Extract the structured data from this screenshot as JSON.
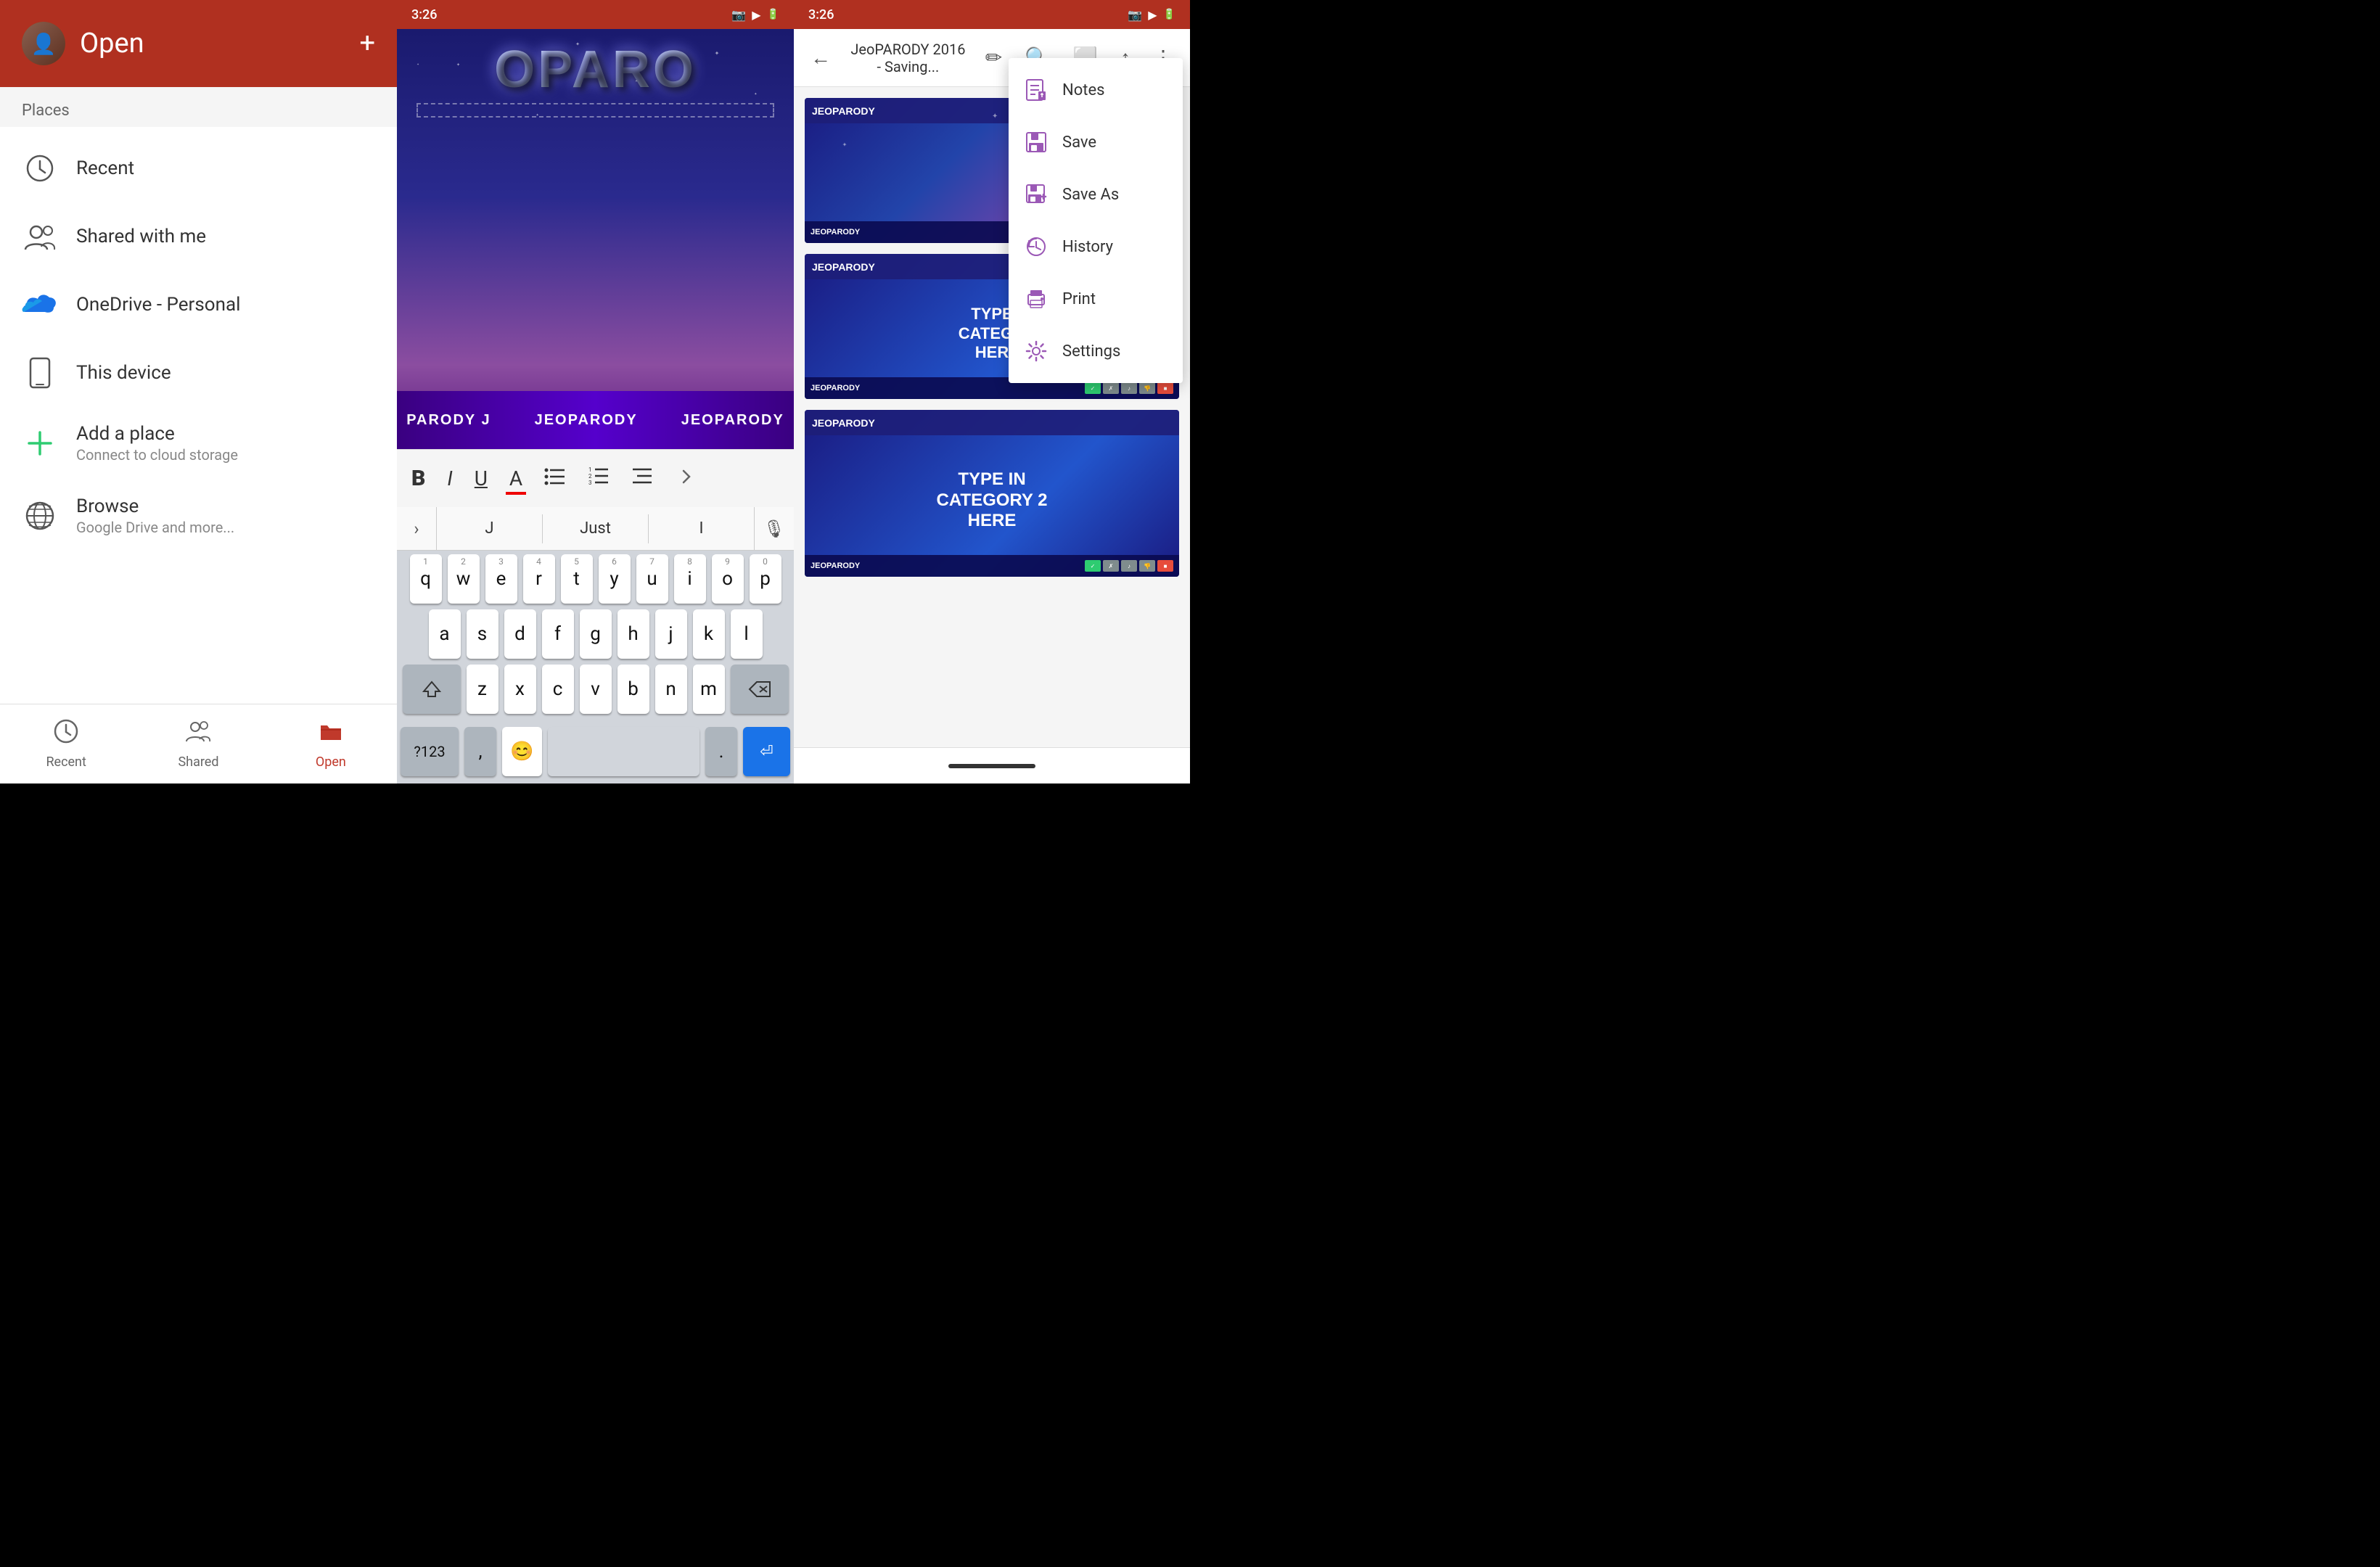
{
  "panel1": {
    "header": {
      "title": "Open",
      "add_btn": "+",
      "avatar_text": "👤"
    },
    "places_label": "Places",
    "nav_items": [
      {
        "id": "recent",
        "label": "Recent",
        "icon": "🕐",
        "sublabel": ""
      },
      {
        "id": "shared",
        "label": "Shared with me",
        "icon": "👥",
        "sublabel": ""
      },
      {
        "id": "onedrive",
        "label": "OneDrive - Personal",
        "icon": "☁",
        "sublabel": "",
        "icon_color": "#1a73e8"
      },
      {
        "id": "device",
        "label": "This device",
        "icon": "📱",
        "sublabel": ""
      },
      {
        "id": "add",
        "label": "Add a place",
        "icon": "➕",
        "sublabel": "Connect to cloud storage",
        "icon_color": "#2ecc71"
      },
      {
        "id": "browse",
        "label": "Browse",
        "icon": "🌐",
        "sublabel": "Google Drive and more..."
      }
    ],
    "bottom_nav": [
      {
        "id": "recent",
        "label": "Recent",
        "icon": "🕐",
        "active": false
      },
      {
        "id": "shared",
        "label": "Shared",
        "icon": "👥",
        "active": false
      },
      {
        "id": "open",
        "label": "Open",
        "icon": "📂",
        "active": true
      }
    ]
  },
  "panel2": {
    "status": {
      "time": "3:26",
      "icons": [
        "📷",
        "▶"
      ]
    },
    "slide": {
      "title": "OPARO",
      "subtitle_parts": [
        "PARODY J",
        "JEOPARODY",
        "JEOPARODY"
      ]
    },
    "toolbar": {
      "bold": "B",
      "italic": "I",
      "underline": "U",
      "color": "A",
      "list1": "≡",
      "list2": "≡"
    },
    "keyboard": {
      "suggestions": [
        "J",
        "Just",
        "I"
      ],
      "rows": [
        [
          "q",
          "w",
          "e",
          "r",
          "t",
          "y",
          "u",
          "i",
          "o",
          "p"
        ],
        [
          "a",
          "s",
          "d",
          "f",
          "g",
          "h",
          "j",
          "k",
          "l"
        ],
        [
          "z",
          "x",
          "c",
          "v",
          "b",
          "n",
          "m"
        ],
        [
          "?123",
          ",",
          "😊",
          " ",
          ".",
          "⏎"
        ]
      ],
      "num_row": [
        "1",
        "2",
        "3",
        "4",
        "5",
        "6",
        "7",
        "8",
        "9",
        "0"
      ]
    }
  },
  "panel3": {
    "status": {
      "time": "3:26",
      "icons": [
        "📷",
        "▶"
      ]
    },
    "topbar": {
      "title": "JeoPARODY 2016 - Saving...",
      "icons": [
        "←",
        "✏",
        "🔍",
        "⬜",
        "↑",
        "⋮"
      ]
    },
    "dropdown": {
      "items": [
        {
          "id": "notes",
          "icon": "📄",
          "label": "Notes",
          "icon_color": "#9b59b6"
        },
        {
          "id": "save",
          "icon": "💾",
          "icon_color": "#9b59b6",
          "label": "Save"
        },
        {
          "id": "saveas",
          "icon": "💾",
          "icon_color": "#9b59b6",
          "label": "Save As"
        },
        {
          "id": "history",
          "icon": "🕐",
          "icon_color": "#9b59b6",
          "label": "History"
        },
        {
          "id": "print",
          "icon": "🖨",
          "icon_color": "#9b59b6",
          "label": "Print"
        },
        {
          "id": "settings",
          "icon": "⚙",
          "icon_color": "#9b59b6",
          "label": "Settings"
        }
      ]
    },
    "slides": [
      {
        "id": "slide1",
        "type": "title",
        "content": "",
        "logo": "JEOPARODY",
        "has_home": true,
        "footer_logo": "JEOPARODY",
        "btns": [
          "✓",
          "×",
          "✗",
          "⬛",
          "🔴"
        ]
      },
      {
        "id": "slide2",
        "type": "category",
        "content": "TYPE IN\nCATEGORY\nHERE",
        "logo": "JEOPARODY",
        "has_home": true,
        "footer_logo": "JEOPARODY",
        "btns": [
          "✓",
          "×",
          "✗",
          "⬛",
          "🔴"
        ]
      },
      {
        "id": "slide3",
        "type": "category2",
        "content": "TYPE IN\nCATEGORY 2\nHERE",
        "logo": "JEOPARODY",
        "has_home": false,
        "footer_logo": "JEOPARODY",
        "btns": [
          "✓",
          "×",
          "✗",
          "⬛",
          "🔴"
        ]
      }
    ]
  }
}
